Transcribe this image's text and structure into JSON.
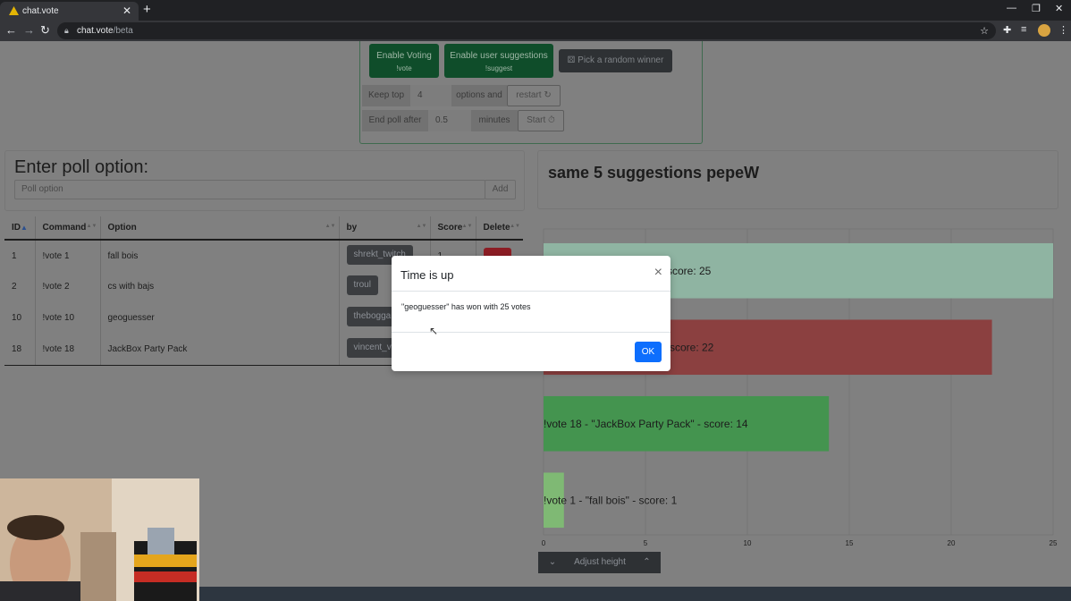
{
  "browser": {
    "tab_title": "chat.vote",
    "tab_close": "✕",
    "new_tab": "+",
    "url_host": "chat.vote",
    "url_path": "/beta",
    "window_controls": [
      "—",
      "❐",
      "✕"
    ]
  },
  "controls": {
    "enable_voting": "Enable Voting",
    "enable_voting_cmd": "!vote",
    "enable_suggestions": "Enable user suggestions",
    "enable_suggestions_cmd": "!suggest",
    "pick_random": "Pick a random winner",
    "keep_top_label": "Keep top",
    "keep_top_value": "4",
    "options_and": "options and",
    "restart": "restart",
    "end_poll_label": "End poll after",
    "end_poll_value": "0.5",
    "minutes": "minutes",
    "start": "Start"
  },
  "poll_entry": {
    "heading": "Enter poll option:",
    "placeholder": "Poll option",
    "add": "Add"
  },
  "table": {
    "headers": [
      "ID",
      "Command",
      "Option",
      "by",
      "Score",
      "Delete"
    ],
    "rows": [
      {
        "id": "1",
        "command": "!vote 1",
        "option": "fall bois",
        "by": "shrekt_twitch",
        "score": "1"
      },
      {
        "id": "2",
        "command": "!vote 2",
        "option": "cs with bajs",
        "by": "troul",
        "score": ""
      },
      {
        "id": "10",
        "command": "!vote 10",
        "option": "geoguesser",
        "by": "theboggart",
        "score": ""
      },
      {
        "id": "18",
        "command": "!vote 18",
        "option": "JackBox Party Pack",
        "by": "vincent_vt",
        "score": ""
      }
    ]
  },
  "poll_title": "same 5 suggestions pepeW",
  "chart_data": {
    "type": "bar",
    "orientation": "horizontal",
    "categories": [
      "!vote 10 - \"geoguesser\"",
      "!vote 2 - \"cs with bajs\"",
      "!vote 18 - \"JackBox Party Pack\"",
      "!vote 1 - \"fall bois\""
    ],
    "values": [
      25,
      22,
      14,
      1
    ],
    "visible_labels": [
      "score: 25",
      "score: 22",
      "!vote 18 - \"JackBox Party Pack\" - score: 14",
      "!vote 1 - \"fall bois\" - score: 1"
    ],
    "colors": [
      "#8fb4a2",
      "#8b4040",
      "#44944f",
      "#7fb974"
    ],
    "xlim": [
      0,
      25
    ],
    "xticks": [
      0,
      5,
      10,
      15,
      20,
      25
    ],
    "grid": true
  },
  "chart_controls": {
    "adjust_height": "Adjust height"
  },
  "modal": {
    "title": "Time is up",
    "close": "×",
    "body": "\"geoguesser\" has won with 25 votes",
    "ok": "OK"
  }
}
